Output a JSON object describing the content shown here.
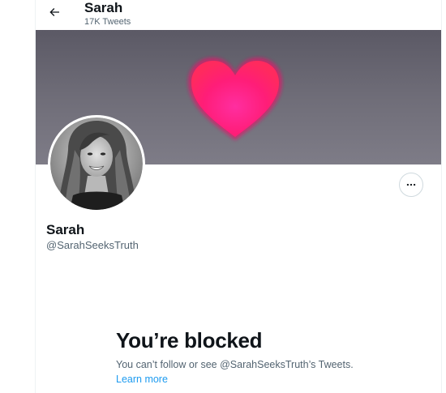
{
  "header": {
    "back_icon": "arrow-left-icon",
    "title": "Sarah",
    "subtitle": "17K Tweets"
  },
  "banner": {
    "icon": "heart-icon",
    "heart_color": "#ff1d78",
    "background_color": "#6b6974"
  },
  "profile": {
    "display_name": "Sarah",
    "handle": "@SarahSeeksTruth",
    "more_icon": "more-horizontal-icon"
  },
  "blocked": {
    "title": "You’re blocked",
    "message": "You can’t follow or see @SarahSeeksTruth’s Tweets.",
    "learn_more": "Learn more",
    "link_color": "#1d9bf0"
  }
}
